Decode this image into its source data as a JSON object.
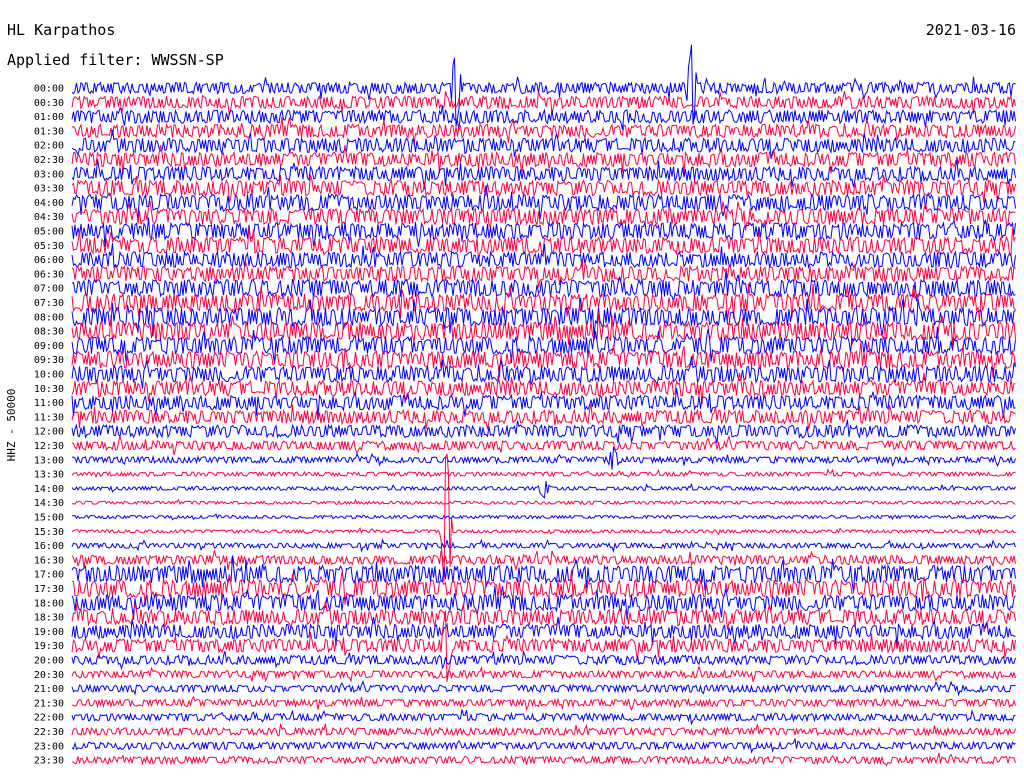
{
  "header": {
    "station": "HL Karpathos",
    "filter": "Applied filter: WWSSN-SP",
    "date": "2021-03-16"
  },
  "chart_data": {
    "type": "line",
    "title": "HL Karpathos",
    "subtitle": "Applied filter: WWSSN-SP",
    "ylabel": "HHZ - 50000",
    "row_labels": [
      "00:00",
      "00:30",
      "01:00",
      "01:30",
      "02:00",
      "02:30",
      "03:00",
      "03:30",
      "04:00",
      "04:30",
      "05:00",
      "05:30",
      "06:00",
      "06:30",
      "07:00",
      "07:30",
      "08:00",
      "08:30",
      "09:00",
      "09:30",
      "10:00",
      "10:30",
      "11:00",
      "11:30",
      "12:00",
      "12:30",
      "13:00",
      "13:30",
      "14:00",
      "14:30",
      "15:00",
      "15:30",
      "16:00",
      "16:30",
      "17:00",
      "17:30",
      "18:00",
      "18:30",
      "19:00",
      "19:30",
      "20:00",
      "20:30",
      "21:00",
      "21:30",
      "22:00",
      "22:30",
      "23:00",
      "23:30"
    ],
    "row_colors": [
      "#0000ff",
      "#ff0040"
    ],
    "x_range_minutes": [
      0,
      30
    ],
    "noise_level": [
      0.55,
      0.6,
      0.65,
      0.65,
      0.7,
      0.7,
      0.7,
      0.75,
      0.8,
      0.8,
      0.8,
      0.8,
      0.75,
      0.75,
      0.85,
      0.85,
      0.9,
      0.9,
      0.85,
      0.85,
      0.8,
      0.75,
      0.7,
      0.65,
      0.6,
      0.45,
      0.3,
      0.2,
      0.18,
      0.15,
      0.15,
      0.15,
      0.25,
      0.45,
      0.85,
      0.85,
      0.8,
      0.75,
      0.7,
      0.65,
      0.45,
      0.35,
      0.35,
      0.35,
      0.35,
      0.35,
      0.35,
      0.35
    ],
    "events": [
      {
        "row": 0,
        "minute": 12.2,
        "amplitude": 5,
        "color": "#0000ff"
      },
      {
        "row": 0,
        "minute": 19.7,
        "amplitude": 6,
        "color": "#0000ff"
      },
      {
        "row": 26,
        "minute": 17.2,
        "amplitude": 1.5,
        "color": "#0000ff"
      },
      {
        "row": 28,
        "minute": 15.0,
        "amplitude": 1.2,
        "color": "#0000ff"
      },
      {
        "row": 31,
        "minute": 11.9,
        "amplitude": 12,
        "color": "#0000ff"
      },
      {
        "row": 39,
        "minute": 11.9,
        "amplitude": 5,
        "color": "#0000ff"
      }
    ]
  }
}
